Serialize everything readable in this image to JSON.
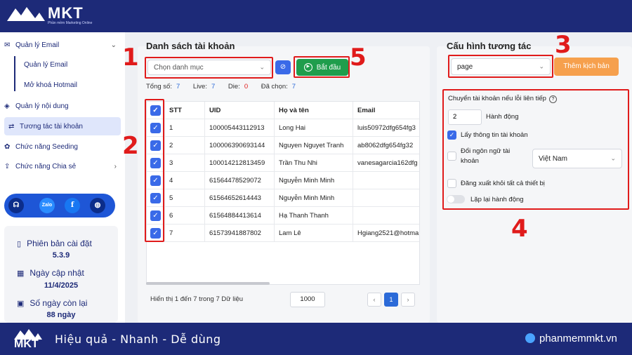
{
  "app": {
    "logo": "MKT",
    "tagline": "Phần mềm Marketing Online"
  },
  "sidebar": {
    "items": [
      {
        "label": "Quản lý Email",
        "icon": "mail-icon"
      },
      {
        "label": "Quản lý nội dung",
        "icon": "layers-icon"
      },
      {
        "label": "Tương tác tài khoản",
        "icon": "interact-icon"
      },
      {
        "label": "Chức năng Seeding",
        "icon": "seeding-icon"
      },
      {
        "label": "Chức năng Chia sẻ",
        "icon": "share-icon"
      }
    ],
    "subitems": [
      "Quản lý Email",
      "Mở khoá Hotmail"
    ],
    "social": [
      "Zalo"
    ],
    "info": {
      "version_label": "Phiên bản cài đặt",
      "version": "5.3.9",
      "update_label": "Ngày cập nhật",
      "update": "11/4/2025",
      "days_label": "Số ngày còn lại",
      "days": "88 ngày"
    }
  },
  "left": {
    "title": "Danh sách tài khoản",
    "category_placeholder": "Chọn danh mục",
    "start_label": "Bắt đầu",
    "stats": {
      "total_label": "Tổng số:",
      "total": "7",
      "live_label": "Live:",
      "live": "7",
      "die_label": "Die:",
      "die": "0",
      "selected_label": "Đã chọn:",
      "selected": "7"
    },
    "columns": [
      "STT",
      "UID",
      "Họ và tên",
      "Email"
    ],
    "rows": [
      {
        "stt": "1",
        "uid": "100005443112913",
        "name": "Long Hai",
        "email": "luis50972dfg654fg3"
      },
      {
        "stt": "2",
        "uid": "100006390693144",
        "name": "Nguyen Nguyet Tranh",
        "email": "ab8062dfg654fg32"
      },
      {
        "stt": "3",
        "uid": "100014212813459",
        "name": "Trần Thu Nhi",
        "email": "vanesagarcia162dfg"
      },
      {
        "stt": "4",
        "uid": "61564478529072",
        "name": "Nguyễn Minh Minh",
        "email": ""
      },
      {
        "stt": "5",
        "uid": "61564652614443",
        "name": "Nguyễn Minh Minh",
        "email": ""
      },
      {
        "stt": "6",
        "uid": "61564884413614",
        "name": "Hạ Thanh Thanh",
        "email": ""
      },
      {
        "stt": "7",
        "uid": "61573941887802",
        "name": "Lam Lê",
        "email": "Hgiang2521@hotma"
      }
    ],
    "footer_text": "Hiển thị 1 đến 7 trong 7 Dữ liệu",
    "page_size": "1000",
    "current_page": "1",
    "prev": "‹",
    "next": "›"
  },
  "right": {
    "title": "Cấu hình tương tác",
    "script_select": "page",
    "add_script_label": "Thêm kịch bản",
    "switch_label": "Chuyển tài khoản nếu lỗi liên tiếp",
    "actions_value": "2",
    "actions_label": "Hành động",
    "get_info_label": "Lấy thông tin tài khoản",
    "change_lang_label_1": "Đổi ngôn ngữ tài",
    "change_lang_label_2": "khoản",
    "language": "Việt Nam",
    "logout_label": "Đăng xuất khỏi tất cả thiết bị",
    "repeat_label": "Lặp lại hành động"
  },
  "annotations": [
    "1",
    "2",
    "3",
    "4",
    "5"
  ],
  "banner": {
    "logo": "MKT",
    "slogan": "Hiệu quả - Nhanh  - Dễ dùng",
    "site": "phanmemmkt.vn"
  },
  "colors": {
    "brand": "#1d2a78",
    "accent": "#3a6ae8",
    "start": "#1f9d4c",
    "add": "#f6a04d",
    "annotation": "#e01b1b"
  }
}
